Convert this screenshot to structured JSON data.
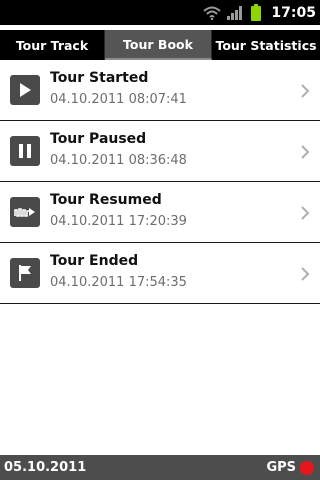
{
  "status_bar": {
    "time": "17:05",
    "icons": [
      "wifi-icon",
      "signal-icon",
      "battery-icon"
    ],
    "battery_color": "#8fd400"
  },
  "tabs": [
    {
      "label": "Tour Track",
      "selected": false
    },
    {
      "label": "Tour Book",
      "selected": true
    },
    {
      "label": "Tour Statistics",
      "selected": false
    }
  ],
  "entries": [
    {
      "title": "Tour Started",
      "time": "04.10.2011 08:07:41",
      "icon": "play-icon"
    },
    {
      "title": "Tour Paused",
      "time": "04.10.2011 08:36:48",
      "icon": "pause-icon"
    },
    {
      "title": "Tour Resumed",
      "time": "04.10.2011 17:20:39",
      "icon": "resume-icon"
    },
    {
      "title": "Tour Ended",
      "time": "04.10.2011 17:54:35",
      "icon": "flag-icon"
    }
  ],
  "bottom_bar": {
    "date": "05.10.2011",
    "gps_label": "GPS",
    "gps_status_color": "#e8161c"
  }
}
